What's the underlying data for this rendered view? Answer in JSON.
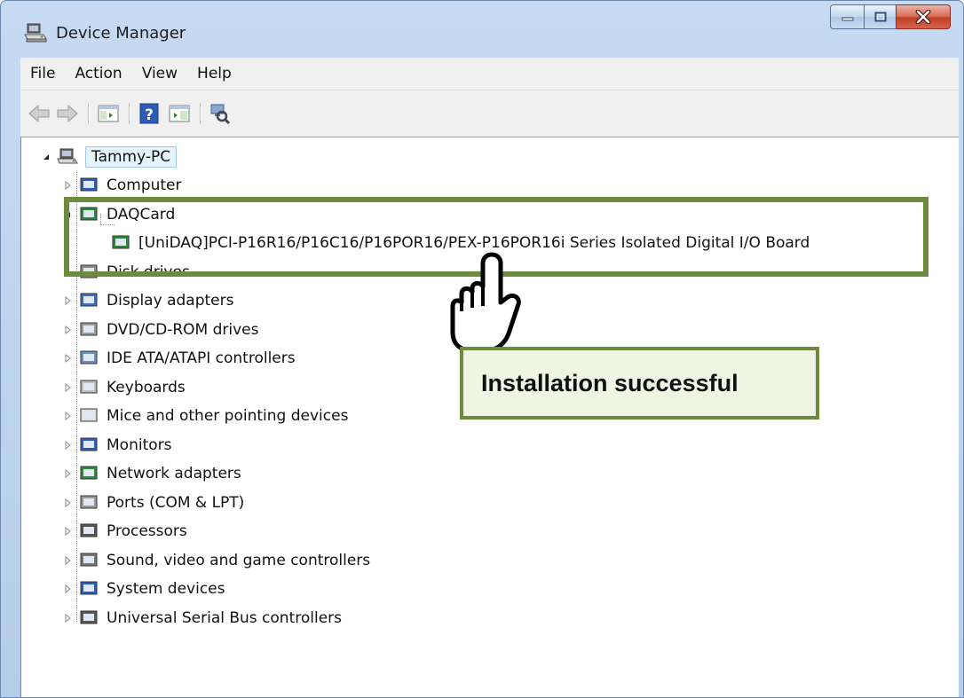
{
  "window": {
    "title": "Device Manager",
    "icons": {
      "title": "device-manager-icon",
      "minimize": "minimize-icon",
      "maximize": "maximize-icon",
      "close": "close-icon"
    },
    "colors": {
      "close_button": "#c24026",
      "titlebar": "#c6dbf3"
    }
  },
  "menu": {
    "items": [
      "File",
      "Action",
      "View",
      "Help"
    ]
  },
  "toolbar": {
    "buttons": [
      "back-arrow-icon",
      "forward-arrow-icon",
      "show-hide-console-tree-icon",
      "help-icon",
      "properties-icon",
      "scan-hardware-changes-icon"
    ]
  },
  "tree": {
    "root": {
      "label": "Tammy-PC",
      "expanded": true,
      "icon": "computer-icon"
    },
    "categories": [
      {
        "label": "Computer",
        "expanded": false,
        "icon": "computer-monitor-icon"
      },
      {
        "label": "DAQCard",
        "expanded": true,
        "icon": "network-card-icon",
        "children": [
          {
            "label": "[UniDAQ]PCI-P16R16/P16C16/P16POR16/PEX-P16POR16i Series Isolated Digital I/O Board",
            "icon": "network-card-icon"
          }
        ]
      },
      {
        "label": "Disk drives",
        "expanded": false,
        "icon": "disk-drive-icon"
      },
      {
        "label": "Display adapters",
        "expanded": false,
        "icon": "display-adapter-icon"
      },
      {
        "label": "DVD/CD-ROM drives",
        "expanded": false,
        "icon": "dvd-drive-icon"
      },
      {
        "label": "IDE ATA/ATAPI controllers",
        "expanded": false,
        "icon": "ide-controller-icon"
      },
      {
        "label": "Keyboards",
        "expanded": false,
        "icon": "keyboard-icon"
      },
      {
        "label": "Mice and other pointing devices",
        "expanded": false,
        "icon": "mouse-icon"
      },
      {
        "label": "Monitors",
        "expanded": false,
        "icon": "monitor-icon"
      },
      {
        "label": "Network adapters",
        "expanded": false,
        "icon": "network-adapter-icon"
      },
      {
        "label": "Ports (COM & LPT)",
        "expanded": false,
        "icon": "port-icon"
      },
      {
        "label": "Processors",
        "expanded": false,
        "icon": "processor-icon"
      },
      {
        "label": "Sound, video and game controllers",
        "expanded": false,
        "icon": "speaker-icon"
      },
      {
        "label": "System devices",
        "expanded": false,
        "icon": "system-device-icon"
      },
      {
        "label": "Universal Serial Bus controllers",
        "expanded": false,
        "icon": "usb-icon"
      }
    ]
  },
  "annotation": {
    "callout_text": "Installation successful",
    "colors": {
      "border": "#6e8b3d",
      "fill": "#eef5e2"
    },
    "pointer_icon": "hand-pointer-icon"
  }
}
